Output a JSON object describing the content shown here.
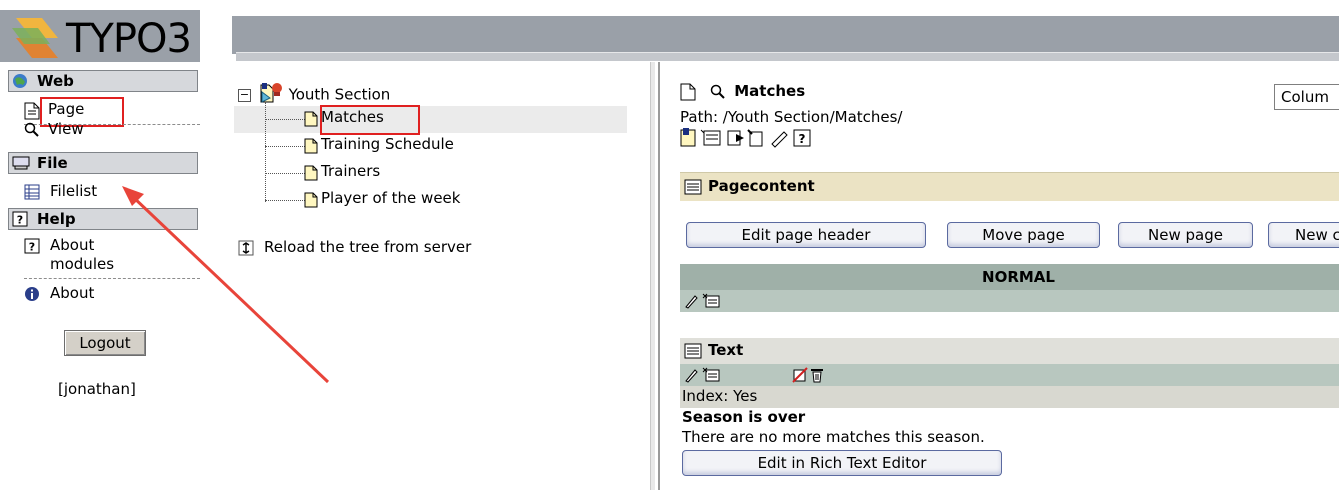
{
  "app": {
    "logo_text": "TYPO3"
  },
  "menu": {
    "categories": [
      {
        "label": "Web",
        "icon": "globe-icon"
      },
      {
        "label": "File",
        "icon": "file-drive-icon"
      },
      {
        "label": "Help",
        "icon": "help-icon"
      }
    ],
    "modules": [
      {
        "label": "Page",
        "icon": "page-icon"
      },
      {
        "label": "View",
        "icon": "magnifier-icon"
      },
      {
        "label": "Filelist",
        "icon": "filelist-icon"
      },
      {
        "label": "About modules",
        "line1": "About",
        "line2": "modules",
        "icon": "help-icon"
      },
      {
        "label": "About",
        "icon": "info-icon"
      }
    ],
    "logout_label": "Logout",
    "username": "[jonathan]"
  },
  "tree": {
    "root": "Youth Section",
    "items": [
      "Matches",
      "Training Schedule",
      "Trainers",
      "Player of the week"
    ],
    "reload_label": "Reload the tree from server"
  },
  "content": {
    "title": "Matches",
    "column_select_value": "Colum",
    "path": "Path: /Youth Section/Matches/",
    "section_label": "Pagecontent",
    "buttons": [
      "Edit page header",
      "Move page",
      "New page",
      "New c"
    ],
    "column_header": "NORMAL",
    "element": {
      "type_label": "Text",
      "index_text": "Index: Yes",
      "heading": "Season is over",
      "body": "There are no more matches this season.",
      "rte_button": "Edit in Rich Text Editor"
    }
  },
  "colors": {
    "highlight_red": "#e02020",
    "arrow_red": "#e8443a",
    "column_header_bg": "#9fb0a8",
    "section_bg": "#ebe3c4",
    "selected_row_bg": "#ebebeb"
  }
}
